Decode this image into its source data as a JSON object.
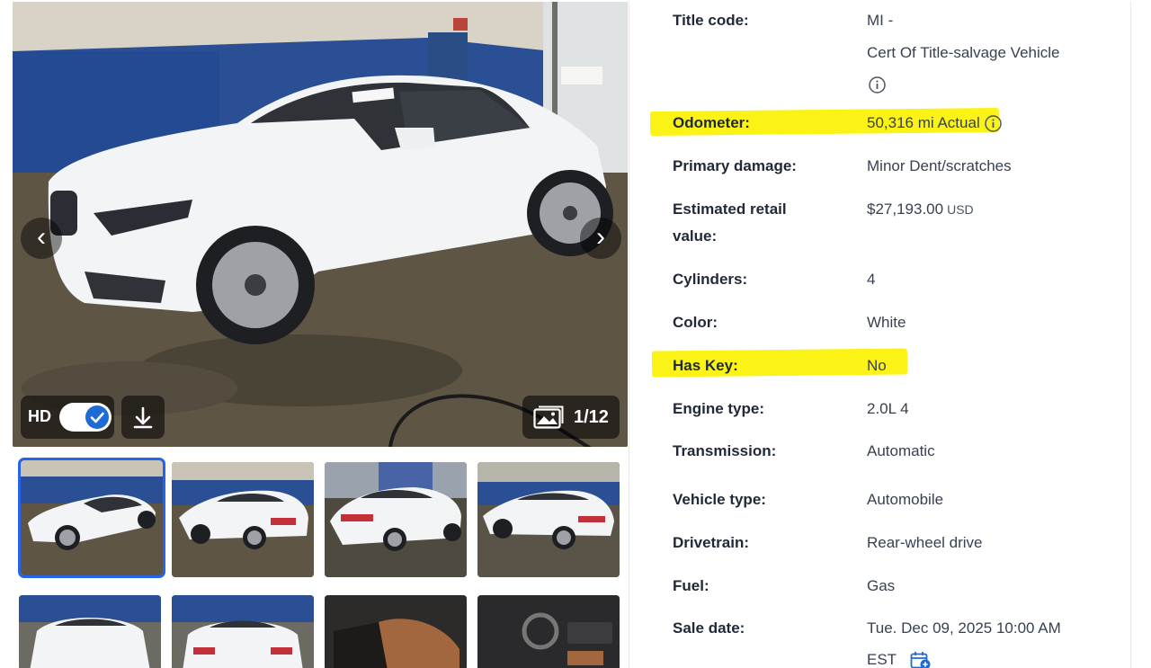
{
  "gallery": {
    "hd_label": "HD",
    "hd_enabled": true,
    "photo_counter": "1/12",
    "thumbnails_count_visible": 8,
    "active_thumbnail": 1
  },
  "details": [
    {
      "key": "title_code",
      "label": "Title code:",
      "value": "MI -",
      "value_line2": "Cert Of Title-salvage Vehicle"
    },
    {
      "key": "odometer",
      "label": "Odometer:",
      "value": "50,316 mi",
      "value_suffix": "Actual",
      "highlighted": true
    },
    {
      "key": "primary_damage",
      "label": "Primary damage:",
      "value": "Minor Dent/scratches"
    },
    {
      "key": "estimated_retail_value",
      "label": "Estimated retail value:",
      "value": "$27,193.00",
      "currency": "USD"
    },
    {
      "key": "cylinders",
      "label": "Cylinders:",
      "value": "4"
    },
    {
      "key": "color",
      "label": "Color:",
      "value": "White"
    },
    {
      "key": "has_key",
      "label": "Has Key:",
      "value": "No",
      "highlighted": true
    },
    {
      "key": "engine_type",
      "label": "Engine type:",
      "value": "2.0L 4"
    },
    {
      "key": "transmission",
      "label": "Transmission:",
      "value": "Automatic"
    },
    {
      "key": "vehicle_type",
      "label": "Vehicle type:",
      "value": "Automobile"
    },
    {
      "key": "drivetrain",
      "label": "Drivetrain:",
      "value": "Rear-wheel drive"
    },
    {
      "key": "fuel",
      "label": "Fuel:",
      "value": "Gas"
    },
    {
      "key": "sale_date",
      "label": "Sale date:",
      "value": "Tue. Dec 09, 2025 10:00 AM",
      "value_line2": "EST"
    }
  ],
  "colors": {
    "highlight": "#fbf315",
    "accent": "#2563eb",
    "label": "#1f2937",
    "value": "#374151"
  },
  "icons": [
    "chevron-left-icon",
    "chevron-right-icon",
    "check-icon",
    "download-icon",
    "gallery-icon",
    "info-icon",
    "calendar-add-icon"
  ]
}
